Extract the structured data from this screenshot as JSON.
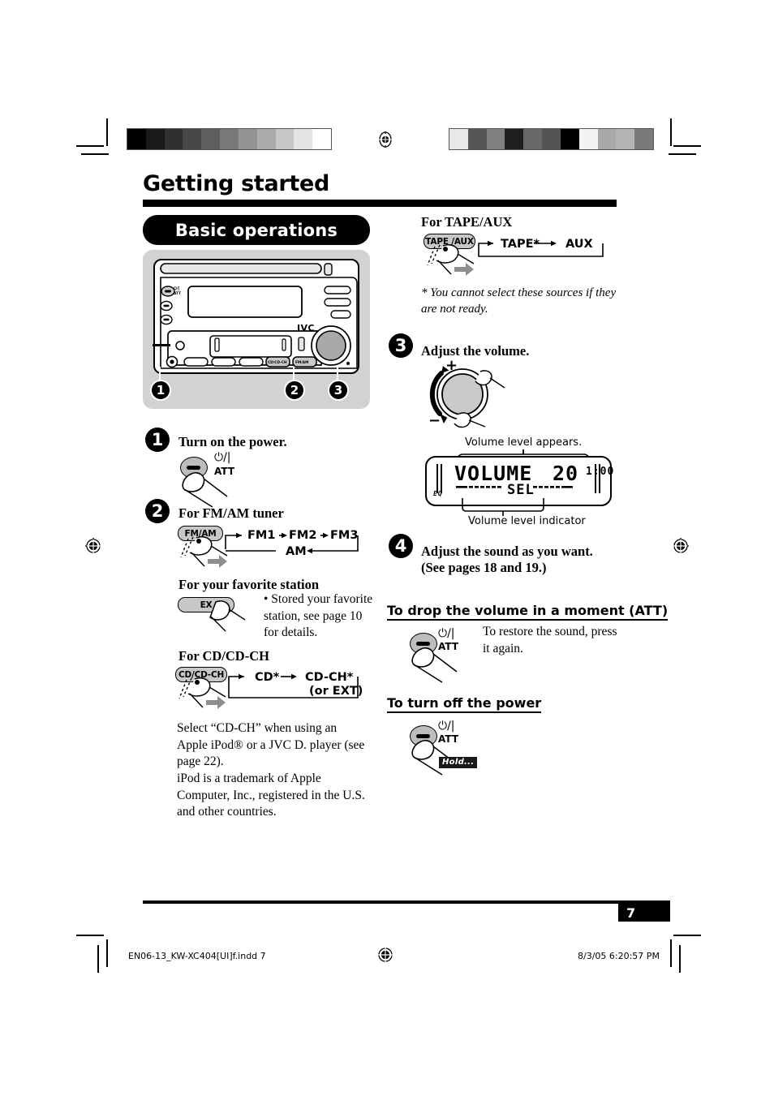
{
  "page": {
    "title": "Getting started",
    "number": "7"
  },
  "banner": {
    "label": "Basic operations"
  },
  "device": {
    "brand": "JVC",
    "callouts": [
      "1",
      "2",
      "3"
    ]
  },
  "steps": {
    "step1": {
      "num": "1",
      "heading": "Turn on the power.",
      "button": {
        "power_glyph": "⏻/|",
        "att_label": "ATT"
      }
    },
    "step2": {
      "num": "2",
      "heading": "For FM/AM tuner",
      "button_label": "FM/AM",
      "flow": [
        "FM1",
        "FM2",
        "FM3",
        "AM"
      ],
      "favorite": {
        "heading": "For your favorite station",
        "button_label": "EX",
        "note": "• Stored your favorite station, see page 10 for details."
      },
      "cd": {
        "heading": "For CD/CD-CH",
        "button_label": "CD/CD-CH",
        "flow": [
          "CD*",
          "CD-CH*",
          "(or EXT)"
        ],
        "note1": "Select “CD-CH” when using an Apple iPod® or a JVC D. player (see page 22).",
        "note2": "iPod is a trademark of Apple Computer, Inc., registered in the U.S. and other countries."
      },
      "tape": {
        "heading": "For TAPE/AUX",
        "button_label": "TAPE /AUX",
        "flow": [
          "TAPE*",
          "AUX"
        ],
        "footnote": "* You cannot select these sources if they are not ready."
      }
    },
    "step3": {
      "num": "3",
      "heading": "Adjust the volume.",
      "knob_plus": "+",
      "knob_minus": "−",
      "caption_top": "Volume level appears.",
      "caption_bottom": "Volume level indicator",
      "lcd": {
        "main": "VOLUME",
        "value": "20",
        "clock": "1:00",
        "sel": "SEL",
        "eq": "EQ"
      }
    },
    "step4": {
      "num": "4",
      "heading_line1": "Adjust the sound as you want.",
      "heading_line2": "(See pages 18 and 19.)"
    }
  },
  "sections": {
    "att": {
      "heading": "To drop the volume in a moment (ATT)",
      "note": "To restore the sound, press it again.",
      "power_glyph": "⏻/|",
      "att_label": "ATT"
    },
    "poweroff": {
      "heading": "To turn off the power",
      "power_glyph": "⏻/|",
      "att_label": "ATT",
      "hold_tag": "Hold..."
    }
  },
  "footer": {
    "filename": "EN06-13_KW-XC404[UI]f.indd   7",
    "timestamp": "8/3/05   6:20:57 PM"
  },
  "calibration": {
    "left_swatches": [
      "#000000",
      "#1a1a1a",
      "#303030",
      "#484848",
      "#5e5e5e",
      "#787878",
      "#949494",
      "#ababab",
      "#c6c6c6",
      "#e4e4e4",
      "#ffffff"
    ],
    "right_swatches": [
      "#e8e8e8",
      "#565656",
      "#808080",
      "#1e1e1e",
      "#686868",
      "#545454",
      "#000000",
      "#f2f2f2",
      "#a8a8a8",
      "#b4b4b4",
      "#7a7a7a"
    ]
  }
}
